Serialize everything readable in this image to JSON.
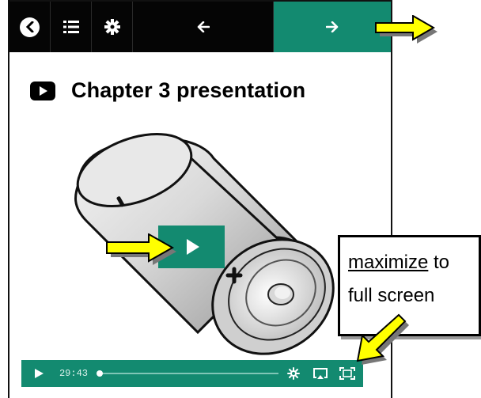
{
  "topbar": {
    "buttons": [
      {
        "name": "back-circle-button",
        "icon": "chevron-left-circle-icon"
      },
      {
        "name": "toc-button",
        "icon": "list-icon"
      },
      {
        "name": "settings-button",
        "icon": "gear-icon"
      },
      {
        "name": "previous-button",
        "icon": "arrow-left-icon"
      },
      {
        "name": "next-button",
        "icon": "arrow-right-icon"
      }
    ],
    "accent": "#138a70"
  },
  "page": {
    "title": "Chapter 3 presentation",
    "title_icon": "video-icon"
  },
  "video": {
    "image": "battery-illustration",
    "time": "29:43",
    "progress": 0.0
  },
  "callout": {
    "word": "maximize",
    "after_word": " to",
    "line2": "full screen"
  }
}
